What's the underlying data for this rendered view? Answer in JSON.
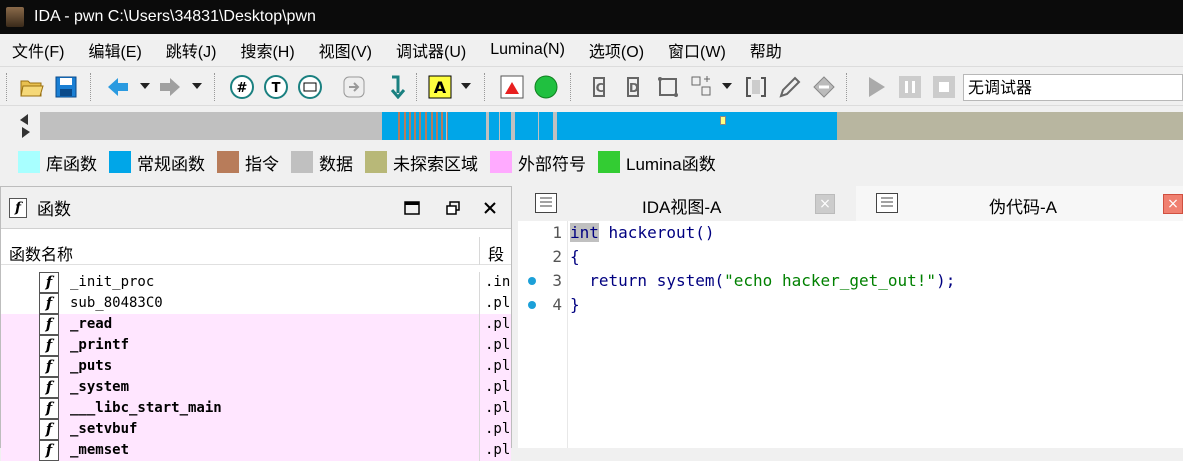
{
  "window": {
    "title": "IDA - pwn C:\\Users\\34831\\Desktop\\pwn"
  },
  "menu": [
    "文件(F)",
    "编辑(E)",
    "跳转(J)",
    "搜索(H)",
    "视图(V)",
    "调试器(U)",
    "Lumina(N)",
    "选项(O)",
    "窗口(W)",
    "帮助"
  ],
  "toolbar": {
    "debugger_select": "无调试器",
    "icons": [
      "open-icon",
      "save-icon",
      "back-icon",
      "forward-icon",
      "hex-view-icon",
      "text-view-icon",
      "graph-overview-icon",
      "jump-icon",
      "step-icon",
      "name-icon",
      "color-icon",
      "run-icon",
      "pause-icon",
      "stop-icon"
    ]
  },
  "legend": [
    {
      "label": "库函数",
      "color": "#a8ffff"
    },
    {
      "label": "常规函数",
      "color": "#00a6e8"
    },
    {
      "label": "指令",
      "color": "#b87c5a"
    },
    {
      "label": "数据",
      "color": "#c0c0c0"
    },
    {
      "label": "未探索区域",
      "color": "#b8b878"
    },
    {
      "label": "外部符号",
      "color": "#ffaaff"
    },
    {
      "label": "Lumina函数",
      "color": "#33cc33"
    }
  ],
  "functions_panel": {
    "title": "函数",
    "col_name": "函数名称",
    "col_segment": "段",
    "rows": [
      {
        "name": "_init_proc",
        "segment": ".init",
        "external": false
      },
      {
        "name": "sub_80483C0",
        "segment": ".plt",
        "external": false
      },
      {
        "name": "_read",
        "segment": ".plt",
        "external": true
      },
      {
        "name": "_printf",
        "segment": ".plt",
        "external": true
      },
      {
        "name": "_puts",
        "segment": ".plt",
        "external": true
      },
      {
        "name": "_system",
        "segment": ".plt",
        "external": true
      },
      {
        "name": "___libc_start_main",
        "segment": ".plt",
        "external": true
      },
      {
        "name": "_setvbuf",
        "segment": ".plt",
        "external": true
      },
      {
        "name": "_memset",
        "segment": ".plt",
        "external": true
      }
    ]
  },
  "tabs": [
    {
      "label": "IDA视图-A",
      "close": "×"
    },
    {
      "label": "伪代码-A",
      "close": "×"
    }
  ],
  "pseudocode": {
    "lines": [
      {
        "num": "1",
        "kw": "int",
        "rest": " hackerout()",
        "dot": false
      },
      {
        "num": "2",
        "text": "{",
        "dot": false
      },
      {
        "num": "3",
        "pre": "  ",
        "kw2": "return",
        "sp": " ",
        "fn": "system",
        "lp": "(",
        "str": "\"echo hacker_get_out!\"",
        "rp": ");",
        "dot": true
      },
      {
        "num": "4",
        "text": "}",
        "dot": true
      }
    ]
  }
}
